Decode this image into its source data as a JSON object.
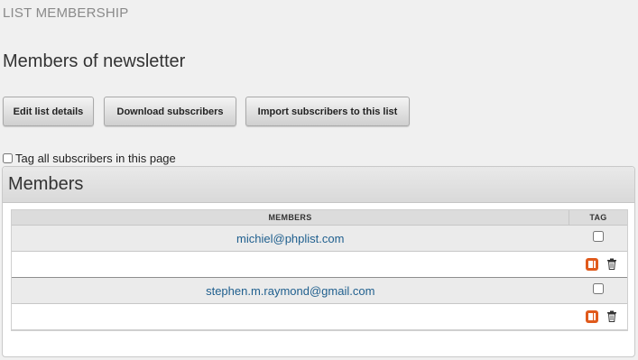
{
  "header": {
    "section_label": "LIST MEMBERSHIP",
    "page_title": "Members of newsletter"
  },
  "buttons": {
    "edit": "Edit list details",
    "download": "Download subscribers",
    "import": "Import subscribers to this list"
  },
  "tag_all": {
    "label": "Tag all subscribers in this page",
    "checked": false
  },
  "panel": {
    "title": "Members"
  },
  "table": {
    "columns": [
      "MEMBERS",
      "TAG"
    ],
    "rows": [
      {
        "email": "michiel@phplist.com",
        "tagged": false
      },
      {
        "email": "stephen.m.raymond@gmail.com",
        "tagged": false
      }
    ]
  },
  "icons": {
    "unsubscribe": "orange-remove-icon",
    "delete": "trash-icon",
    "accent_color": "#e05a1c"
  }
}
